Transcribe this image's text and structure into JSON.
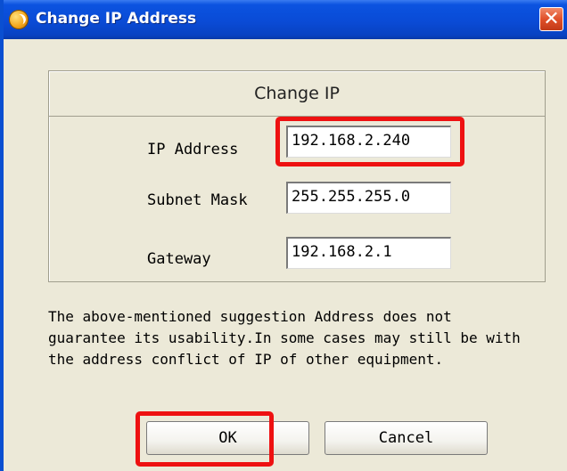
{
  "window": {
    "title": "Change IP Address",
    "close_glyph": "✕"
  },
  "group": {
    "title": "Change IP"
  },
  "fields": {
    "ip": {
      "label": "IP Address",
      "value": "192.168.2.240"
    },
    "subnet": {
      "label": "Subnet Mask",
      "value": "255.255.255.0"
    },
    "gateway": {
      "label": "Gateway",
      "value": "192.168.2.1"
    }
  },
  "notice": "The above-mentioned suggestion Address does not\nguarantee its usability.In some cases may still be with\nthe address conflict of IP of other equipment.",
  "buttons": {
    "ok": "OK",
    "cancel": "Cancel"
  },
  "colors": {
    "titlebar": "#0a4bd6",
    "highlight": "#ee1111",
    "dialog_bg": "#ece9d8"
  },
  "icons": {
    "app": "app-icon",
    "close": "close-icon"
  }
}
